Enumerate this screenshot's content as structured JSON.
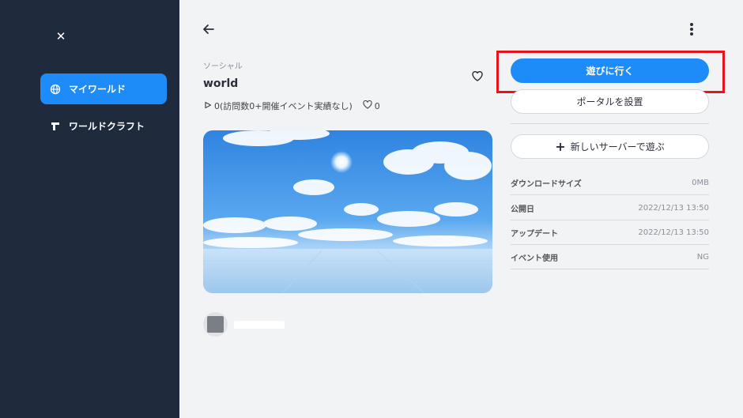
{
  "sidebar": {
    "close_icon": "close-icon",
    "items": [
      {
        "label": "マイワールド",
        "icon": "globe-icon",
        "active": true
      },
      {
        "label": "ワールドクラフト",
        "icon": "craft-icon",
        "active": false
      }
    ]
  },
  "header": {
    "back_icon": "arrow-left-icon",
    "more_icon": "more-vertical-icon"
  },
  "world": {
    "category": "ソーシャル",
    "title": "world",
    "stats_visits": "0(訪問数0+開催イベント実績なし)",
    "likes": "0"
  },
  "actions": {
    "play_label": "遊びに行く",
    "portal_label": "ポータルを設置",
    "new_server_label": "新しいサーバーで遊ぶ"
  },
  "info": [
    {
      "key": "ダウンロードサイズ",
      "value": "0MB"
    },
    {
      "key": "公開日",
      "value": "2022/12/13 13:50"
    },
    {
      "key": "アップデート",
      "value": "2022/12/13 13:50"
    },
    {
      "key": "イベント使用",
      "value": "NG"
    }
  ],
  "colors": {
    "primary": "#1d8cf8",
    "sidebar": "#1f2a3d",
    "highlight": "#e8141b"
  }
}
